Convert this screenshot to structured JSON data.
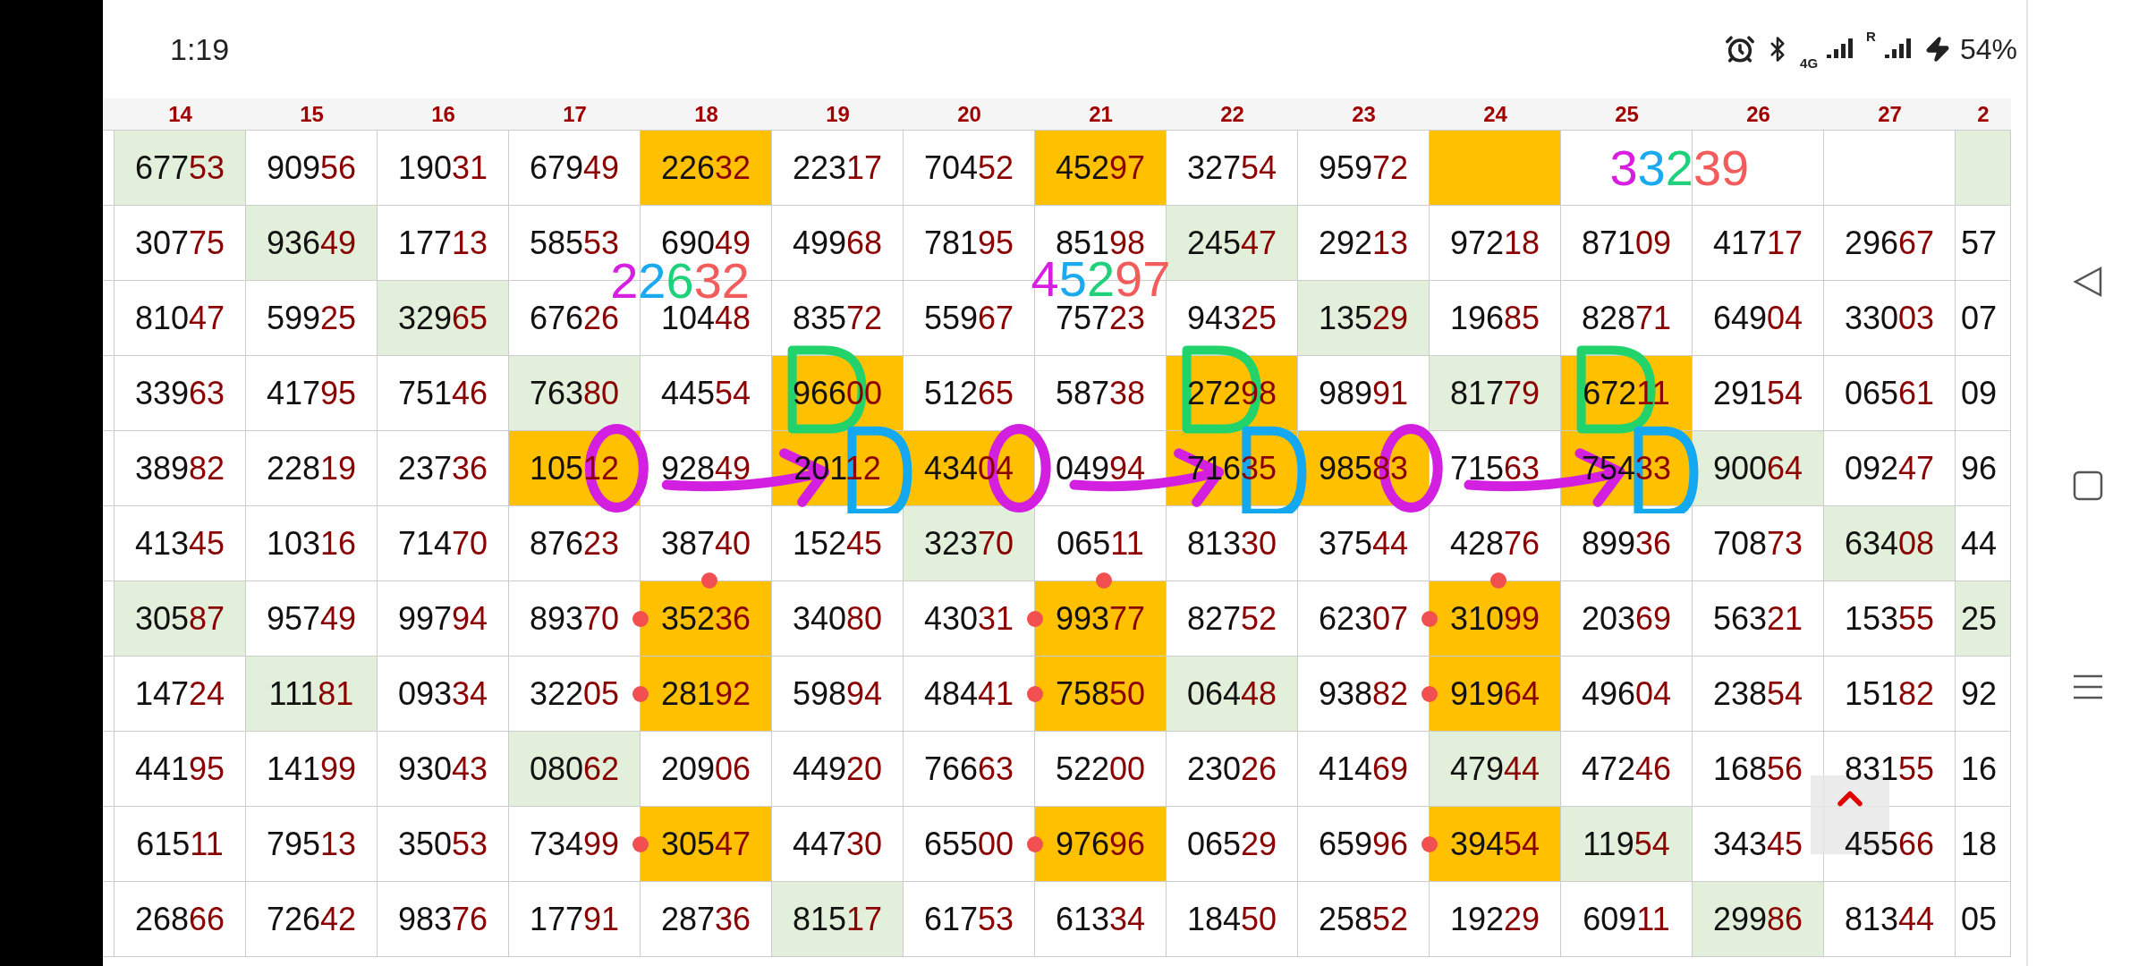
{
  "status_bar": {
    "time": "1:19",
    "network": "4G",
    "roaming": "R",
    "battery": "54%"
  },
  "table": {
    "columns": [
      "14",
      "15",
      "16",
      "17",
      "18",
      "19",
      "20",
      "21",
      "22",
      "23",
      "24",
      "25",
      "26",
      "27",
      "2"
    ],
    "rows": [
      {
        "cells": [
          {
            "value": "67753",
            "color": "#e2efda"
          },
          {
            "value": "90956",
            "color": "#ffffff"
          },
          {
            "value": "19031",
            "color": "#ffffff"
          },
          {
            "value": "67949",
            "color": "#ffffff"
          },
          {
            "value": "22632",
            "color": "#ffc000"
          },
          {
            "value": "22317",
            "color": "#ffffff"
          },
          {
            "value": "70452",
            "color": "#ffffff"
          },
          {
            "value": "45297",
            "color": "#ffc000"
          },
          {
            "value": "32754",
            "color": "#ffffff"
          },
          {
            "value": "95972",
            "color": "#ffffff"
          },
          {
            "color": "#ffc000"
          },
          {
            "color": "#ffffff"
          },
          {
            "color": "#ffffff"
          },
          {
            "color": "#ffffff"
          },
          {
            "color": "#e2efda"
          }
        ]
      },
      {
        "cells": [
          {
            "value": "30775",
            "color": "#ffffff"
          },
          {
            "value": "93649",
            "color": "#e2efda"
          },
          {
            "value": "17713",
            "color": "#ffffff"
          },
          {
            "value": "58553",
            "color": "#ffffff"
          },
          {
            "value": "69049",
            "color": "#ffffff"
          },
          {
            "value": "49968",
            "color": "#ffffff"
          },
          {
            "value": "78195",
            "color": "#ffffff"
          },
          {
            "value": "85198",
            "color": "#ffffff"
          },
          {
            "value": "24547",
            "color": "#e2efda"
          },
          {
            "value": "29213",
            "color": "#ffffff"
          },
          {
            "value": "97218",
            "color": "#ffffff"
          },
          {
            "value": "87109",
            "color": "#ffffff"
          },
          {
            "value": "41717",
            "color": "#ffffff"
          },
          {
            "value": "29667",
            "color": "#ffffff"
          },
          {
            "value": "57",
            "color": "#ffffff"
          }
        ]
      },
      {
        "cells": [
          {
            "value": "81047",
            "color": "#ffffff"
          },
          {
            "value": "59925",
            "color": "#ffffff"
          },
          {
            "value": "32965",
            "color": "#e2efda"
          },
          {
            "value": "67626",
            "color": "#ffffff"
          },
          {
            "value": "10448",
            "color": "#ffffff"
          },
          {
            "value": "83572",
            "color": "#ffffff"
          },
          {
            "value": "55967",
            "color": "#ffffff"
          },
          {
            "value": "75723",
            "color": "#ffffff"
          },
          {
            "value": "94325",
            "color": "#ffffff"
          },
          {
            "value": "13529",
            "color": "#e2efda"
          },
          {
            "value": "19685",
            "color": "#ffffff"
          },
          {
            "value": "82871",
            "color": "#ffffff"
          },
          {
            "value": "64904",
            "color": "#ffffff"
          },
          {
            "value": "33003",
            "color": "#ffffff"
          },
          {
            "value": "07",
            "color": "#ffffff"
          }
        ]
      },
      {
        "cells": [
          {
            "value": "33963",
            "color": "#ffffff"
          },
          {
            "value": "41795",
            "color": "#ffffff"
          },
          {
            "value": "75146",
            "color": "#ffffff"
          },
          {
            "value": "76380",
            "color": "#e2efda"
          },
          {
            "value": "44554",
            "color": "#ffffff"
          },
          {
            "value": "96600",
            "color": "#ffc000"
          },
          {
            "value": "51265",
            "color": "#ffffff"
          },
          {
            "value": "58738",
            "color": "#ffffff"
          },
          {
            "value": "27298",
            "color": "#ffc000"
          },
          {
            "value": "98991",
            "color": "#ffffff"
          },
          {
            "value": "81779",
            "color": "#e2efda"
          },
          {
            "value": "67211",
            "color": "#ffc000"
          },
          {
            "value": "29154",
            "color": "#ffffff"
          },
          {
            "value": "06561",
            "color": "#ffffff"
          },
          {
            "value": "09",
            "color": "#ffffff"
          }
        ]
      },
      {
        "cells": [
          {
            "value": "38982",
            "color": "#ffffff"
          },
          {
            "value": "22819",
            "color": "#ffffff"
          },
          {
            "value": "23736",
            "color": "#ffffff"
          },
          {
            "value": "10512",
            "color": "#ffc000"
          },
          {
            "value": "92849",
            "color": "#ffffff"
          },
          {
            "value": "20112",
            "color": "#ffc000"
          },
          {
            "value": "43404",
            "color": "#ffc000"
          },
          {
            "value": "04994",
            "color": "#ffffff"
          },
          {
            "value": "71635",
            "color": "#ffc000"
          },
          {
            "value": "98583",
            "color": "#ffc000"
          },
          {
            "value": "71563",
            "color": "#ffffff"
          },
          {
            "value": "75433",
            "color": "#ffc000"
          },
          {
            "value": "90064",
            "color": "#e2efda"
          },
          {
            "value": "09247",
            "color": "#ffffff"
          },
          {
            "value": "96",
            "color": "#ffffff"
          }
        ]
      },
      {
        "cells": [
          {
            "value": "41345",
            "color": "#ffffff"
          },
          {
            "value": "10316",
            "color": "#ffffff"
          },
          {
            "value": "71470",
            "color": "#ffffff"
          },
          {
            "value": "87623",
            "color": "#ffffff"
          },
          {
            "value": "38740",
            "color": "#ffffff"
          },
          {
            "value": "15245",
            "color": "#ffffff"
          },
          {
            "value": "32370",
            "color": "#e2efda"
          },
          {
            "value": "06511",
            "color": "#ffffff"
          },
          {
            "value": "81330",
            "color": "#ffffff"
          },
          {
            "value": "37544",
            "color": "#ffffff"
          },
          {
            "value": "42876",
            "color": "#ffffff"
          },
          {
            "value": "89936",
            "color": "#ffffff"
          },
          {
            "value": "70873",
            "color": "#ffffff"
          },
          {
            "value": "63408",
            "color": "#e2efda"
          },
          {
            "value": "44",
            "color": "#ffffff"
          }
        ]
      },
      {
        "cells": [
          {
            "value": "30587",
            "color": "#e2efda"
          },
          {
            "value": "95749",
            "color": "#ffffff"
          },
          {
            "value": "99794",
            "color": "#ffffff"
          },
          {
            "value": "89370",
            "color": "#ffffff"
          },
          {
            "value": "35236",
            "color": "#ffc000",
            "marker_left": true,
            "marker_top": true
          },
          {
            "value": "34080",
            "color": "#ffffff"
          },
          {
            "value": "43031",
            "color": "#ffffff"
          },
          {
            "value": "99377",
            "color": "#ffc000",
            "marker_left": true,
            "marker_top": true
          },
          {
            "value": "82752",
            "color": "#ffffff"
          },
          {
            "value": "62307",
            "color": "#ffffff"
          },
          {
            "value": "31099",
            "color": "#ffc000",
            "marker_left": true,
            "marker_top": true
          },
          {
            "value": "20369",
            "color": "#ffffff"
          },
          {
            "value": "56321",
            "color": "#ffffff"
          },
          {
            "value": "15355",
            "color": "#ffffff"
          },
          {
            "value": "25",
            "color": "#e2efda"
          }
        ]
      },
      {
        "cells": [
          {
            "value": "14724",
            "color": "#ffffff"
          },
          {
            "value": "11181",
            "color": "#e2efda"
          },
          {
            "value": "09334",
            "color": "#ffffff"
          },
          {
            "value": "32205",
            "color": "#ffffff"
          },
          {
            "value": "28192",
            "color": "#ffc000",
            "marker_left": true,
            "marker_top": false
          },
          {
            "value": "59894",
            "color": "#ffffff"
          },
          {
            "value": "48441",
            "color": "#ffffff"
          },
          {
            "value": "75850",
            "color": "#ffc000",
            "marker_left": true,
            "marker_top": false
          },
          {
            "value": "06448",
            "color": "#e2efda"
          },
          {
            "value": "93882",
            "color": "#ffffff"
          },
          {
            "value": "91964",
            "color": "#ffc000",
            "marker_left": true,
            "marker_top": false
          },
          {
            "value": "49604",
            "color": "#ffffff"
          },
          {
            "value": "23854",
            "color": "#ffffff"
          },
          {
            "value": "15182",
            "color": "#ffffff"
          },
          {
            "value": "92",
            "color": "#ffffff"
          }
        ]
      },
      {
        "cells": [
          {
            "value": "44195",
            "color": "#ffffff"
          },
          {
            "value": "14199",
            "color": "#ffffff"
          },
          {
            "value": "93043",
            "color": "#ffffff"
          },
          {
            "value": "08062",
            "color": "#e2efda"
          },
          {
            "value": "20906",
            "color": "#ffffff"
          },
          {
            "value": "44920",
            "color": "#ffffff"
          },
          {
            "value": "76663",
            "color": "#ffffff"
          },
          {
            "value": "52200",
            "color": "#ffffff"
          },
          {
            "value": "23026",
            "color": "#ffffff"
          },
          {
            "value": "41469",
            "color": "#ffffff"
          },
          {
            "value": "47944",
            "color": "#e2efda"
          },
          {
            "value": "47246",
            "color": "#ffffff"
          },
          {
            "value": "16856",
            "color": "#ffffff"
          },
          {
            "value": "83155",
            "color": "#ffffff"
          },
          {
            "value": "16",
            "color": "#ffffff"
          }
        ]
      },
      {
        "cells": [
          {
            "value": "61511",
            "color": "#ffffff"
          },
          {
            "value": "79513",
            "color": "#ffffff"
          },
          {
            "value": "35053",
            "color": "#ffffff"
          },
          {
            "value": "73499",
            "color": "#ffffff"
          },
          {
            "value": "30547",
            "color": "#ffc000",
            "marker_left": true,
            "marker_top": false
          },
          {
            "value": "44730",
            "color": "#ffffff"
          },
          {
            "value": "65500",
            "color": "#ffffff"
          },
          {
            "value": "97696",
            "color": "#ffc000",
            "marker_left": true,
            "marker_top": false
          },
          {
            "value": "06529",
            "color": "#ffffff"
          },
          {
            "value": "65996",
            "color": "#ffffff"
          },
          {
            "value": "39454",
            "color": "#ffc000",
            "marker_left": true,
            "marker_top": false
          },
          {
            "value": "11954",
            "color": "#e2efda"
          },
          {
            "value": "34345",
            "color": "#ffffff"
          },
          {
            "value": "45566",
            "color": "#ffffff"
          },
          {
            "value": "18",
            "color": "#ffffff"
          }
        ]
      },
      {
        "cells": [
          {
            "value": "26866",
            "color": "#ffffff"
          },
          {
            "value": "72642",
            "color": "#ffffff"
          },
          {
            "value": "98376",
            "color": "#ffffff"
          },
          {
            "value": "17791",
            "color": "#ffffff"
          },
          {
            "value": "28736",
            "color": "#ffffff"
          },
          {
            "value": "81517",
            "color": "#e2efda"
          },
          {
            "value": "61753",
            "color": "#ffffff"
          },
          {
            "value": "61334",
            "color": "#ffffff"
          },
          {
            "value": "18450",
            "color": "#ffffff"
          },
          {
            "value": "25852",
            "color": "#ffffff"
          },
          {
            "value": "19229",
            "color": "#ffffff"
          },
          {
            "value": "60911",
            "color": "#ffffff"
          },
          {
            "value": "29986",
            "color": "#e2efda"
          },
          {
            "value": "81344",
            "color": "#ffffff"
          },
          {
            "value": "05",
            "color": "#ffffff"
          }
        ]
      }
    ]
  },
  "handwritten": [
    "22632",
    "45297",
    "33239"
  ]
}
